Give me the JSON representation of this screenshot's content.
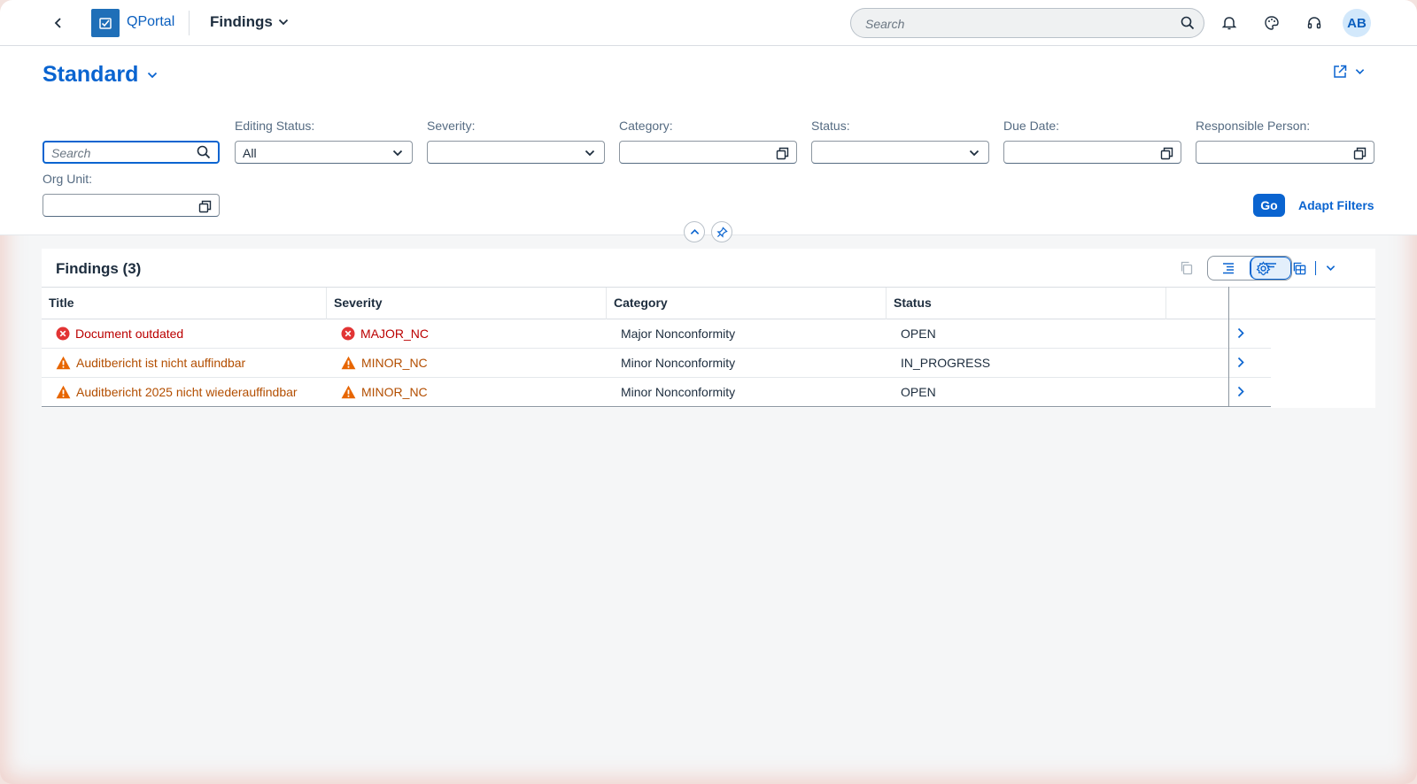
{
  "shell": {
    "app_name": "QPortal",
    "page_title": "Findings",
    "search_placeholder": "Search",
    "avatar_initials": "AB"
  },
  "header": {
    "variant_name": "Standard"
  },
  "filters": {
    "search_placeholder": "Search",
    "editing_status": {
      "label": "Editing Status:",
      "value": "All"
    },
    "severity": {
      "label": "Severity:",
      "value": ""
    },
    "category": {
      "label": "Category:",
      "value": ""
    },
    "status": {
      "label": "Status:",
      "value": ""
    },
    "due_date": {
      "label": "Due Date:",
      "value": ""
    },
    "responsible_person": {
      "label": "Responsible Person:",
      "value": ""
    },
    "org_unit": {
      "label": "Org Unit:",
      "value": ""
    },
    "go_label": "Go",
    "adapt_label": "Adapt Filters"
  },
  "table": {
    "title": "Findings (3)",
    "columns": [
      "Title",
      "Severity",
      "Category",
      "Status"
    ],
    "rows": [
      {
        "title": "Document outdated",
        "severity": "MAJOR_NC",
        "category": "Major Nonconformity",
        "status": "OPEN",
        "level": "error"
      },
      {
        "title": "Auditbericht ist nicht auffindbar",
        "severity": "MINOR_NC",
        "category": "Minor Nonconformity",
        "status": "IN_PROGRESS",
        "level": "warning"
      },
      {
        "title": "Auditbericht 2025 nicht wiederauffindbar",
        "severity": "MINOR_NC",
        "category": "Minor Nonconformity",
        "status": "OPEN",
        "level": "warning"
      }
    ]
  },
  "colors": {
    "accent": "#0a64d0",
    "error": "#bb0000",
    "warning": "#b34e00",
    "error_icon": "#e23434",
    "warning_icon": "#e76500"
  },
  "icons": {
    "back": "chevron-left-icon",
    "logo": "qportal-logo-icon",
    "search": "search-icon",
    "notifications": "bell-icon",
    "theme": "palette-icon",
    "support": "headset-icon",
    "share": "share-icon",
    "value_help": "value-help-icon",
    "dropdown": "chevron-down-icon",
    "collapse": "chevron-up-icon",
    "pin": "pin-icon",
    "copy": "copy-icon",
    "settings": "gear-icon",
    "export": "export-icon",
    "nav": "chevron-right-icon",
    "error": "error-circle-icon",
    "warning": "warning-triangle-icon"
  }
}
